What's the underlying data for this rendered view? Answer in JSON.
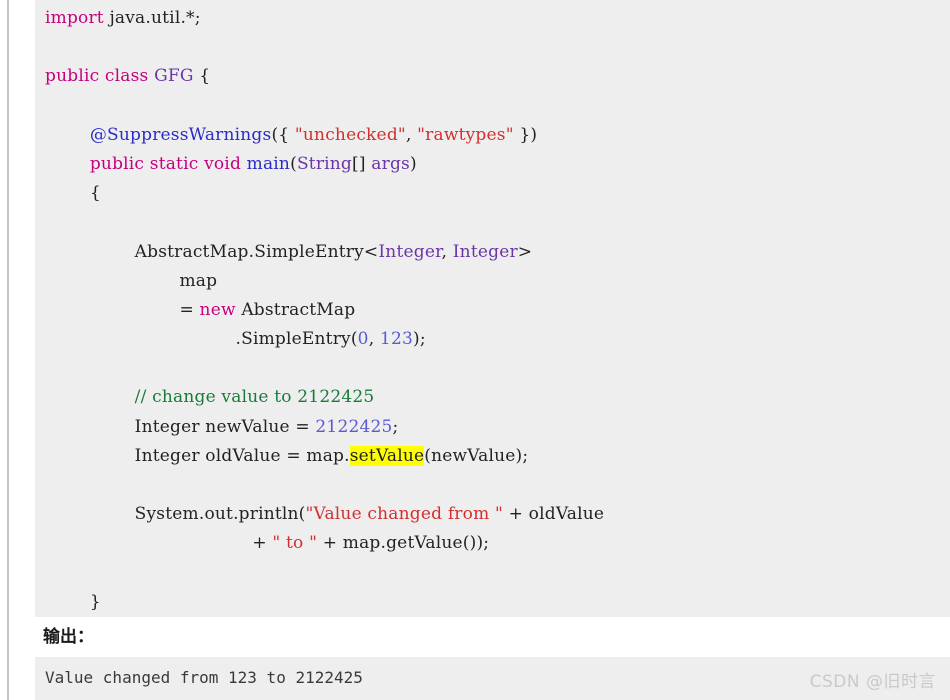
{
  "page": {
    "background": "#ffffff",
    "code_background": "#eeeeee",
    "left_rule_color": "#c2c2c2"
  },
  "colors": {
    "keyword": "#c6007e",
    "type": "#6a35a8",
    "function": "#2b2bc8",
    "string": "#d32f2f",
    "number": "#5a5ad6",
    "comment": "#1a7a3c",
    "plain": "#222222",
    "highlight_bg": "#ffff00"
  },
  "code": {
    "language": "java",
    "lines": [
      {
        "id": "l1",
        "tokens": [
          {
            "t": "import",
            "c": "kw"
          },
          {
            "t": " java.util.*;",
            "c": "pln"
          }
        ]
      },
      {
        "id": "l2",
        "tokens": []
      },
      {
        "id": "l3",
        "tokens": [
          {
            "t": "public",
            "c": "kw"
          },
          {
            "t": " ",
            "c": "pln"
          },
          {
            "t": "class",
            "c": "kw"
          },
          {
            "t": " ",
            "c": "pln"
          },
          {
            "t": "GFG",
            "c": "typ"
          },
          {
            "t": " {",
            "c": "pln"
          }
        ]
      },
      {
        "id": "l4",
        "tokens": []
      },
      {
        "id": "l5",
        "tokens": [
          {
            "t": "        ",
            "c": "pln"
          },
          {
            "t": "@SuppressWarnings",
            "c": "fn"
          },
          {
            "t": "({ ",
            "c": "pln"
          },
          {
            "t": "\"unchecked\"",
            "c": "str"
          },
          {
            "t": ", ",
            "c": "pln"
          },
          {
            "t": "\"rawtypes\"",
            "c": "str"
          },
          {
            "t": " })",
            "c": "pln"
          }
        ]
      },
      {
        "id": "l6",
        "tokens": [
          {
            "t": "        ",
            "c": "pln"
          },
          {
            "t": "public",
            "c": "kw"
          },
          {
            "t": " ",
            "c": "pln"
          },
          {
            "t": "static",
            "c": "kw"
          },
          {
            "t": " ",
            "c": "pln"
          },
          {
            "t": "void",
            "c": "kw"
          },
          {
            "t": " ",
            "c": "pln"
          },
          {
            "t": "main",
            "c": "fn"
          },
          {
            "t": "(",
            "c": "pln"
          },
          {
            "t": "String",
            "c": "typ"
          },
          {
            "t": "[] ",
            "c": "pln"
          },
          {
            "t": "args",
            "c": "typ"
          },
          {
            "t": ")",
            "c": "pln"
          }
        ]
      },
      {
        "id": "l7",
        "tokens": [
          {
            "t": "        {",
            "c": "pln"
          }
        ]
      },
      {
        "id": "l8",
        "tokens": []
      },
      {
        "id": "l9",
        "tokens": [
          {
            "t": "                AbstractMap.SimpleEntry<",
            "c": "pln"
          },
          {
            "t": "Integer",
            "c": "typ"
          },
          {
            "t": ", ",
            "c": "pln"
          },
          {
            "t": "Integer",
            "c": "typ"
          },
          {
            "t": ">",
            "c": "pln"
          }
        ]
      },
      {
        "id": "l10",
        "tokens": [
          {
            "t": "                        map",
            "c": "pln"
          }
        ]
      },
      {
        "id": "l11",
        "tokens": [
          {
            "t": "                        = ",
            "c": "pln"
          },
          {
            "t": "new",
            "c": "kw"
          },
          {
            "t": " AbstractMap",
            "c": "pln"
          }
        ]
      },
      {
        "id": "l12",
        "tokens": [
          {
            "t": "                                  .SimpleEntry(",
            "c": "pln"
          },
          {
            "t": "0",
            "c": "num"
          },
          {
            "t": ", ",
            "c": "pln"
          },
          {
            "t": "123",
            "c": "num"
          },
          {
            "t": ");",
            "c": "pln"
          }
        ]
      },
      {
        "id": "l13",
        "tokens": []
      },
      {
        "id": "l14",
        "tokens": [
          {
            "t": "                ",
            "c": "pln"
          },
          {
            "t": "// change value to 2122425",
            "c": "cmt"
          }
        ]
      },
      {
        "id": "l15",
        "tokens": [
          {
            "t": "                Integer newValue = ",
            "c": "pln"
          },
          {
            "t": "2122425",
            "c": "num"
          },
          {
            "t": ";",
            "c": "pln"
          }
        ]
      },
      {
        "id": "l16",
        "tokens": [
          {
            "t": "                Integer oldValue = map.",
            "c": "pln"
          },
          {
            "t": "setValue",
            "c": "hl"
          },
          {
            "t": "(newValue);",
            "c": "pln"
          }
        ]
      },
      {
        "id": "l17",
        "tokens": []
      },
      {
        "id": "l18",
        "tokens": [
          {
            "t": "                System.out.println(",
            "c": "pln"
          },
          {
            "t": "\"Value changed from \"",
            "c": "str"
          },
          {
            "t": " + oldValue",
            "c": "pln"
          }
        ]
      },
      {
        "id": "l19",
        "tokens": [
          {
            "t": "                                     + ",
            "c": "pln"
          },
          {
            "t": "\" to \"",
            "c": "str"
          },
          {
            "t": " + map.getValue());",
            "c": "pln"
          }
        ]
      },
      {
        "id": "l20",
        "tokens": []
      },
      {
        "id": "l21",
        "tokens": [
          {
            "t": "        }",
            "c": "pln"
          }
        ]
      },
      {
        "id": "l22",
        "tokens": [
          {
            "t": "}",
            "c": "pln"
          }
        ]
      }
    ]
  },
  "output": {
    "label": "输出：",
    "text": "Value changed from 123 to 2122425"
  },
  "watermark": {
    "text": "CSDN @旧时言"
  }
}
